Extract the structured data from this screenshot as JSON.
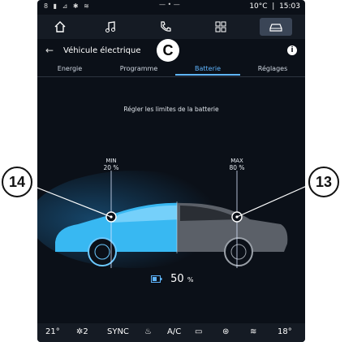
{
  "statusbar": {
    "left_icons": "8 ▮ ⊿ ✱ ≋",
    "center": "— • —",
    "temperature": "10°C",
    "time": "15:03"
  },
  "appbar": {
    "icons": [
      "home-icon",
      "music-icon",
      "phone-icon",
      "apps-icon",
      "car-icon"
    ],
    "active": "car-icon"
  },
  "header": {
    "back": "←",
    "title": "Véhicule électrique",
    "info": "i"
  },
  "tabs": [
    {
      "label": "Energie"
    },
    {
      "label": "Programme"
    },
    {
      "label": "Batterie"
    },
    {
      "label": "Réglages"
    }
  ],
  "active_tab": "Batterie",
  "main": {
    "prompt": "Régler les limites de la batterie",
    "min": {
      "label": "MIN",
      "value": "20 %"
    },
    "max": {
      "label": "MAX",
      "value": "80 %"
    },
    "battery_level": "50",
    "battery_unit": "%"
  },
  "bottombar": {
    "temp_left": "21°",
    "fan": "2",
    "sync": "SYNC",
    "ac": "A/C",
    "temp_right": "18°"
  },
  "callouts": {
    "left": "14",
    "right": "13",
    "badge": "C"
  },
  "colors": {
    "accent": "#5fb5ff",
    "car_blue": "#38b8f2",
    "background": "#0b1018"
  }
}
